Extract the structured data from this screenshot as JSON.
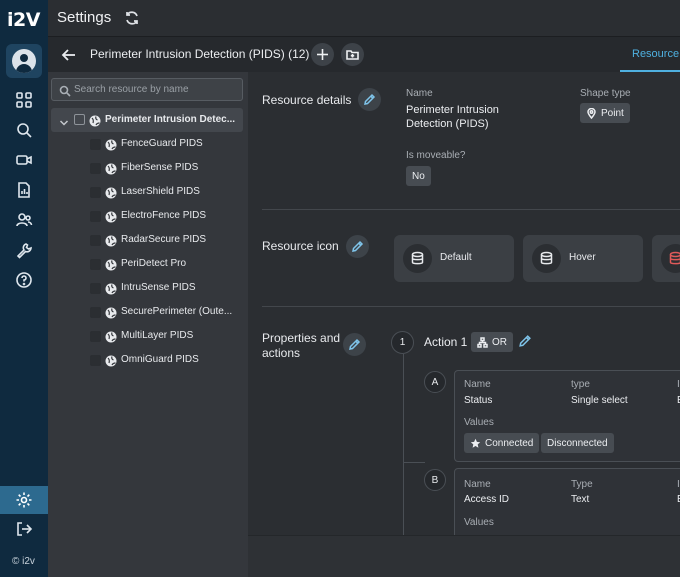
{
  "app": {
    "logo": "i2V",
    "copyright": "© i2v"
  },
  "topbar": {
    "title": "Settings"
  },
  "subheader": {
    "title": "Perimeter Intrusion Detection (PIDS) (12)",
    "active_tab": "Resource d"
  },
  "tree": {
    "search_placeholder": "Search resource by name",
    "root_label": "Perimeter Intrusion Detec...",
    "items": [
      {
        "label": "FenceGuard PIDS"
      },
      {
        "label": "FiberSense PIDS"
      },
      {
        "label": "LaserShield PIDS"
      },
      {
        "label": "ElectroFence PIDS"
      },
      {
        "label": "RadarSecure PIDS"
      },
      {
        "label": "PeriDetect Pro"
      },
      {
        "label": "IntruSense PIDS"
      },
      {
        "label": "SecurePerimeter (Oute..."
      },
      {
        "label": "MultiLayer PIDS"
      },
      {
        "label": "OmniGuard PIDS"
      }
    ]
  },
  "details": {
    "section_label": "Resource details",
    "name_label": "Name",
    "name_value": "Perimeter Intrusion Detection (PIDS)",
    "shape_label": "Shape type",
    "shape_value": "Point",
    "moveable_label": "Is moveable?",
    "moveable_value": "No"
  },
  "resource_icon": {
    "section_label": "Resource icon",
    "cards": [
      {
        "label": "Default"
      },
      {
        "label": "Hover"
      }
    ]
  },
  "properties": {
    "section_label": "Properties and actions",
    "action": {
      "number": "1",
      "label": "Action 1",
      "operator": "OR"
    },
    "props": [
      {
        "letter": "A",
        "name_label": "Name",
        "name_value": "Status",
        "type_label": "type",
        "type_value": "Single select",
        "extra_label": "I",
        "extra_value": "E",
        "values_label": "Values",
        "values": [
          "Connected",
          "Disconnected"
        ]
      },
      {
        "letter": "B",
        "name_label": "Name",
        "name_value": "Access ID",
        "type_label": "Type",
        "type_value": "Text",
        "extra_label": "I",
        "extra_value": "E",
        "values_label": "Values"
      }
    ]
  },
  "colors": {
    "accent": "#4fb0e0",
    "rail": "#0f2a3f",
    "hover_icon": "#e05a5a"
  }
}
